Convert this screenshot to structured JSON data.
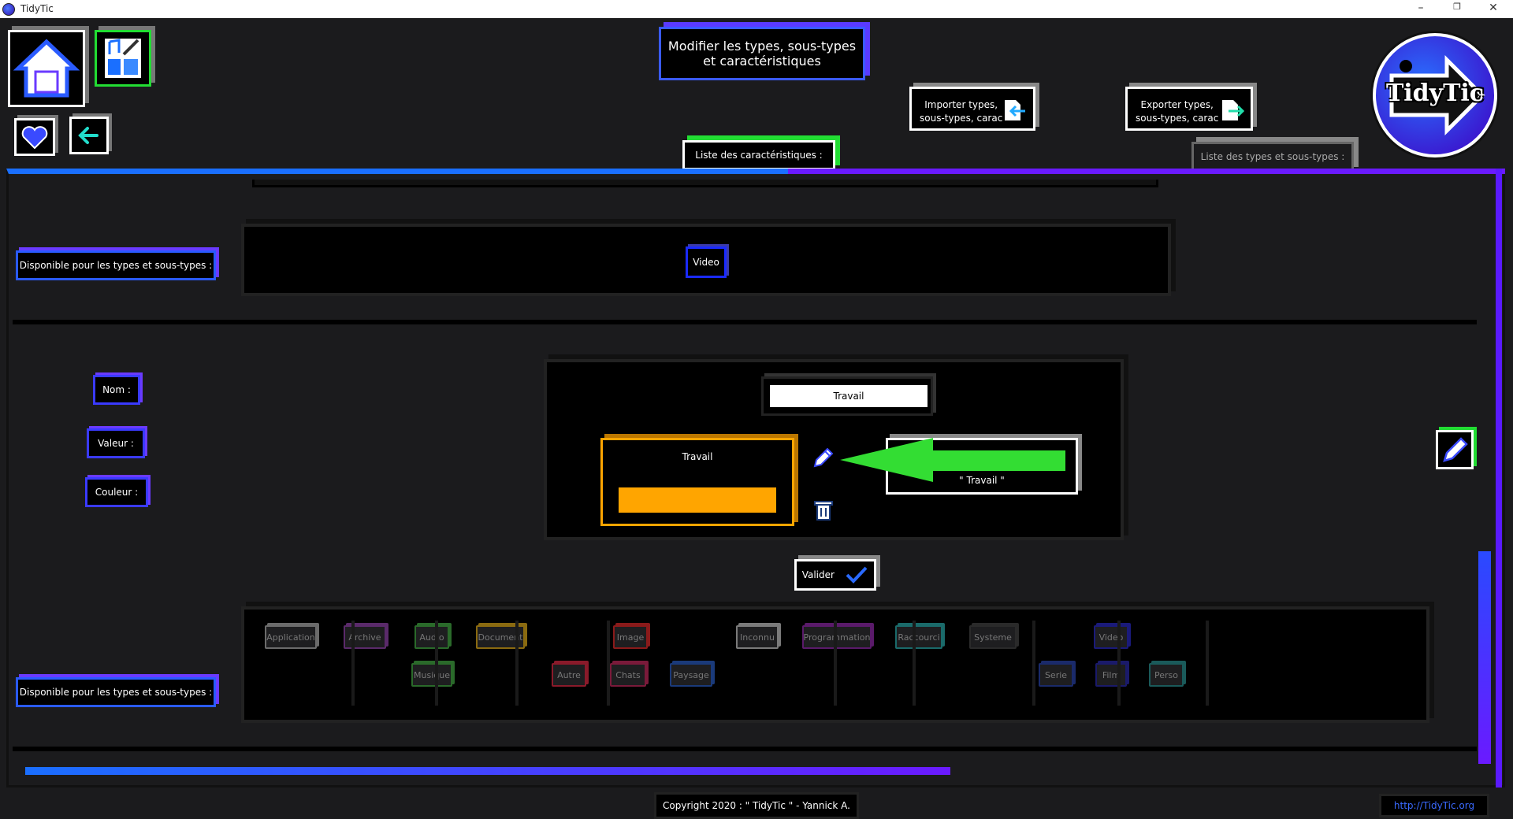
{
  "window": {
    "title": "TidyTic",
    "minimize": "–",
    "restore": "❐",
    "close": "✕"
  },
  "header": {
    "page_title_line1": "Modifier les types, sous-types",
    "page_title_line2": "et caractéristiques",
    "import_line1": "Importer types,",
    "import_line2": "sous-types, carac",
    "export_line1": "Exporter types,",
    "export_line2": "sous-types, carac",
    "tab_caracteristiques": "Liste des caractéristiques :",
    "tab_types": "Liste des types et sous-types :",
    "logo_text": "TidyTic"
  },
  "top_section": {
    "available_label": "Disponible pour les types et sous-types :",
    "selected_chip": "Video"
  },
  "form": {
    "name_label": "Nom :",
    "value_label": "Valeur :",
    "color_label": "Couleur :",
    "name_value": "Travail",
    "card_title": "Travail",
    "card_color": "#ffa500",
    "right_box_line1": ":",
    "right_box_line2": "\" Travail \"",
    "validate_label": "Valider"
  },
  "bottom_section": {
    "available_label": "Disponible pour les types et sous-types :",
    "tags": [
      {
        "label": "Application",
        "color": "#6b6b6b"
      },
      {
        "label": "Archive",
        "color": "#5a2a6a"
      },
      {
        "label": "Audio",
        "color": "#2a6a2a"
      },
      {
        "label": "Musique",
        "color": "#2a6a2a"
      },
      {
        "label": "Document",
        "color": "#8a6a10"
      },
      {
        "label": "Image",
        "color": "#8a1a1a"
      },
      {
        "label": "Autre",
        "color": "#8a1a2a"
      },
      {
        "label": "Chats",
        "color": "#7a1a3a"
      },
      {
        "label": "Paysage",
        "color": "#1a3a7a"
      },
      {
        "label": "Inconnu",
        "color": "#7a7a7a"
      },
      {
        "label": "Programmation",
        "color": "#5a1a6a"
      },
      {
        "label": "Raccourci",
        "color": "#1a6a6a"
      },
      {
        "label": "Systeme",
        "color": "#2a2a2a"
      },
      {
        "label": "Video",
        "color": "#1a1a7a"
      },
      {
        "label": "Serie",
        "color": "#1a2a6a"
      },
      {
        "label": "Film",
        "color": "#1a1a6a"
      },
      {
        "label": "Perso",
        "color": "#1a5a5a"
      }
    ]
  },
  "footer": {
    "copyright": "Copyright 2020 : \" TidyTic \" - Yannick A.",
    "link": "http://TidyTic.org"
  },
  "colors": {
    "accent_blue": "#1a6fff",
    "accent_purple": "#6a1aff",
    "accent_green": "#22dd33"
  }
}
